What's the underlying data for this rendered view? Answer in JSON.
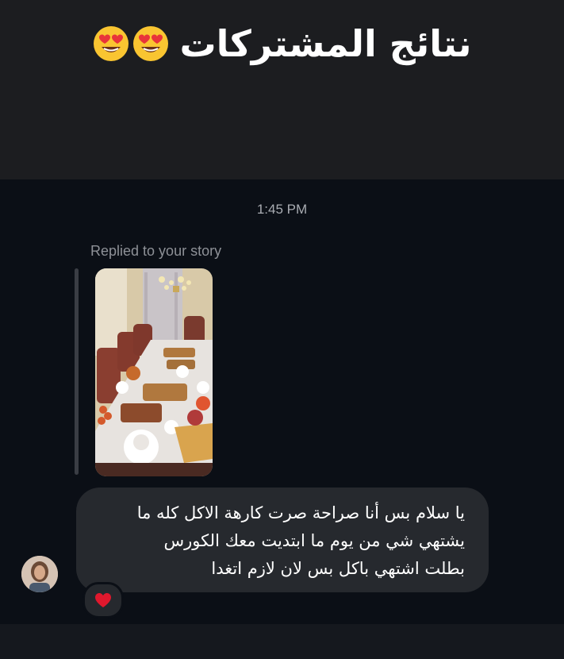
{
  "banner": {
    "title": "نتائج المشتركات",
    "emoji_icon": "heart-eyes-emoji-icon"
  },
  "chat": {
    "timestamp": "1:45 PM",
    "replied_label": "Replied to your story",
    "message_lines": [
      "يا سلام بس أنا صراحة صرت كارهة الاكل كله ما",
      "يشتهي شي من يوم ما ابتديت معك الكورس",
      "بطلت اشتهي باكل بس لان لازم اتغدا"
    ],
    "reaction_icon": "red-heart-icon"
  },
  "colors": {
    "banner_bg": "#1c1d20",
    "chat_bg": "#0b0f16",
    "bubble_bg": "#26292e",
    "timestamp_text": "#a9acb2",
    "reaction_heart": "#e0182d"
  }
}
